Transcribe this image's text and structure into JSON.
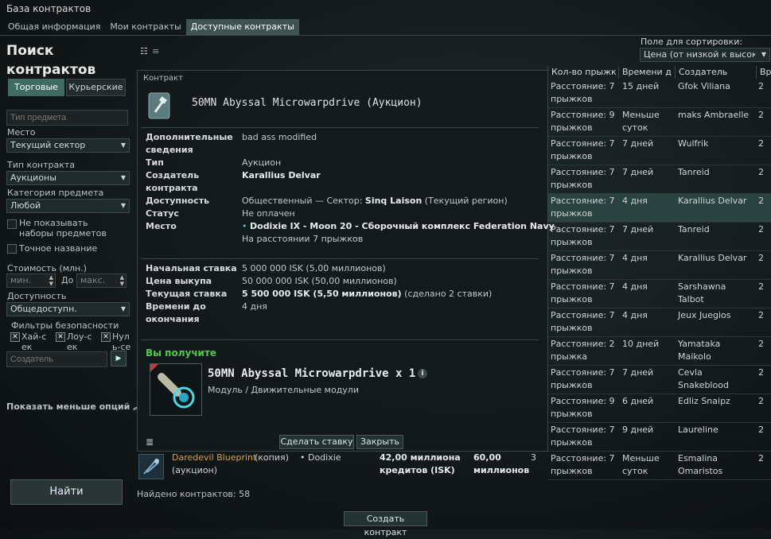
{
  "window": {
    "title": "База контрактов",
    "tabs": [
      "Общая информация",
      "Мои контракты",
      "Доступные контракты"
    ]
  },
  "search": {
    "title_line1": "Поиск",
    "title_line2": "контрактов",
    "seg_trade": "Торговые",
    "seg_courier": "Курьерские",
    "item_type_placeholder": "Тип предмета",
    "location_label": "Место",
    "location_value": "Текущий сектор",
    "contract_type_label": "Тип контракта",
    "contract_type_value": "Аукционы",
    "category_label": "Категория предмета",
    "category_value": "Любой",
    "hide_sets_label": "Не показывать наборы предметов",
    "exact_name_label": "Точное название",
    "price_label": "Стоимость (млн.)",
    "min_placeholder": "мин.",
    "to_label": "До",
    "max_placeholder": "макс.",
    "availability_label": "Доступность",
    "availability_value": "Общедоступн.",
    "security_label": "Фильтры безопасности",
    "sec_high": "Хай-сек",
    "sec_low": "Лоу-сек",
    "sec_null": "Нуль-сек",
    "creator_placeholder": "Создатель",
    "play_glyph": "▶",
    "show_less": "Показать меньше опций",
    "find_button": "Найти",
    "found_label": "Найдено контрактов: 58",
    "create_button": "Создать контракт"
  },
  "sort": {
    "label": "Поле для сортировки:",
    "value": "Цена (от низкой к высокой)"
  },
  "columns": [
    "Кол-во прыжк",
    "Времени д",
    "Создатель",
    "Вр"
  ],
  "rows": [
    {
      "jumps1": "Расстояние: 7",
      "jumps2": "прыжков",
      "time1": "15 дней",
      "time2": "",
      "creator1": "Gfok Viliana",
      "creator2": "",
      "extra": "2"
    },
    {
      "jumps1": "Расстояние: 9",
      "jumps2": "прыжков",
      "time1": "Меньше",
      "time2": "суток",
      "creator1": "maks Ambraelle",
      "creator2": "",
      "extra": "2"
    },
    {
      "jumps1": "Расстояние: 7",
      "jumps2": "прыжков",
      "time1": "7 дней",
      "time2": "",
      "creator1": "Wulfrik",
      "creator2": "",
      "extra": "2"
    },
    {
      "jumps1": "Расстояние: 7",
      "jumps2": "прыжков",
      "time1": "7 дней",
      "time2": "",
      "creator1": "Tanreid",
      "creator2": "",
      "extra": "2"
    },
    {
      "jumps1": "Расстояние: 7",
      "jumps2": "прыжков",
      "time1": "4 дня",
      "time2": "",
      "creator1": "Karallius Delvar",
      "creator2": "",
      "extra": "2"
    },
    {
      "jumps1": "Расстояние: 7",
      "jumps2": "прыжков",
      "time1": "7 дней",
      "time2": "",
      "creator1": "Tanreid",
      "creator2": "",
      "extra": "2"
    },
    {
      "jumps1": "Расстояние: 7",
      "jumps2": "прыжков",
      "time1": "4 дня",
      "time2": "",
      "creator1": "Karallius Delvar",
      "creator2": "",
      "extra": "2"
    },
    {
      "jumps1": "Расстояние: 7",
      "jumps2": "прыжков",
      "time1": "4 дня",
      "time2": "",
      "creator1": "Sarshawna",
      "creator2": "Talbot",
      "extra": "2"
    },
    {
      "jumps1": "Расстояние: 7",
      "jumps2": "прыжков",
      "time1": "4 дня",
      "time2": "",
      "creator1": "Jeux Juegios",
      "creator2": "",
      "extra": "2"
    },
    {
      "jumps1": "Расстояние: 2",
      "jumps2": "прыжка",
      "time1": "10 дней",
      "time2": "",
      "creator1": "Yamataka",
      "creator2": "Maikolo",
      "extra": "2"
    },
    {
      "jumps1": "Расстояние: 7",
      "jumps2": "прыжков",
      "time1": "7 дней",
      "time2": "",
      "creator1": "Cevla",
      "creator2": "Snakeblood",
      "extra": "2"
    },
    {
      "jumps1": "Расстояние: 9",
      "jumps2": "прыжков",
      "time1": "6 дней",
      "time2": "",
      "creator1": "Edliz Snaipz",
      "creator2": "",
      "extra": "2"
    },
    {
      "jumps1": "Расстояние: 7",
      "jumps2": "прыжков",
      "time1": "9 дней",
      "time2": "",
      "creator1": "Laureline",
      "creator2": "",
      "extra": "2"
    },
    {
      "jumps1": "Расстояние: 7",
      "jumps2": "прыжков",
      "time1": "Меньше",
      "time2": "суток",
      "creator1": "Esmalina",
      "creator2": "Omaristos",
      "extra": "2"
    }
  ],
  "bottom_row": {
    "name": "Daredevil Blueprint",
    "copy": "(копия)",
    "kind": "(аукцион)",
    "location": "• Dodixie",
    "price1": "42,00 миллиона",
    "price2": "кредитов (ISK)",
    "buyout1": "60,00",
    "buyout2": "миллионов",
    "count": "3"
  },
  "modal": {
    "header": "Контракт",
    "title": "50MN Abyssal Microwarpdrive (Аукцион)",
    "info_label": "Дополнительные сведения",
    "info_value": "bad ass modified",
    "type_label": "Тип",
    "type_value": "Аукцион",
    "creator_label": "Создатель контракта",
    "creator_value": "Karallius Delvar",
    "avail_label": "Доступность",
    "avail_value_a": "Общественный — Сектор: ",
    "avail_value_b": "Sinq Laison",
    "avail_value_c": " (Текущий регион)",
    "status_label": "Статус",
    "status_value": "Не оплачен",
    "place_label": "Место",
    "place_value": "Dodixie IX - Moon 20 - Сборочный комплекс Federation Navy",
    "place_distance": "На расстоянии 7 прыжков",
    "start_label": "Начальная ставка",
    "start_value": "5 000 000 ISK (5,00 миллионов)",
    "buyout_label": "Цена выкупа",
    "buyout_value": "50 000 000 ISK (50,00 миллионов)",
    "current_label": "Текущая ставка",
    "current_value": "5 500 000 ISK (5,50 миллионов)",
    "current_note": " (сделано 2 ставки)",
    "time_label": "Времени до окончания",
    "time_value": "4 дня",
    "receive_label": "Вы получите",
    "item_name": "50MN Abyssal Microwarpdrive x 1",
    "item_category": "Модуль / Движительные модули",
    "bid_button": "Сделать ставку",
    "close_button": "Закрыть"
  },
  "colors": {
    "accent": "#3f6b63",
    "receive_green": "#4fc94a",
    "blueprint_orange": "#d8a34a"
  }
}
